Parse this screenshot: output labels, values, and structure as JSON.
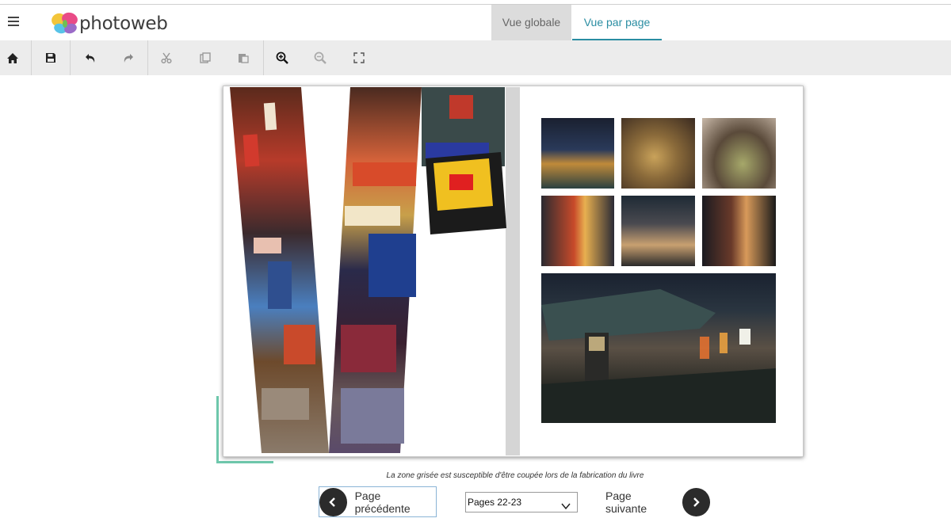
{
  "header": {
    "logo_text": "photoweb",
    "tabs": [
      {
        "label": "Vue globale",
        "active": false
      },
      {
        "label": "Vue par page",
        "active": true
      }
    ]
  },
  "toolbar": {
    "icons": [
      "home-icon",
      "save-icon",
      "undo-icon",
      "redo-icon",
      "cut-icon",
      "copy-icon",
      "paste-icon",
      "zoom-in-icon",
      "zoom-out-icon",
      "fullscreen-icon"
    ]
  },
  "notice": "La zone grisée est susceptible d'être coupée lors de la fabrication du livre",
  "nav": {
    "prev_label": "Page précédente",
    "next_label": "Page suivante",
    "page_select_value": "Pages 22-23"
  },
  "colors": {
    "accent": "#2a8da2",
    "guide": "#6ec7ac",
    "active_tab_bg": "#dcdcdc",
    "toolbar_bg": "#ececec"
  }
}
